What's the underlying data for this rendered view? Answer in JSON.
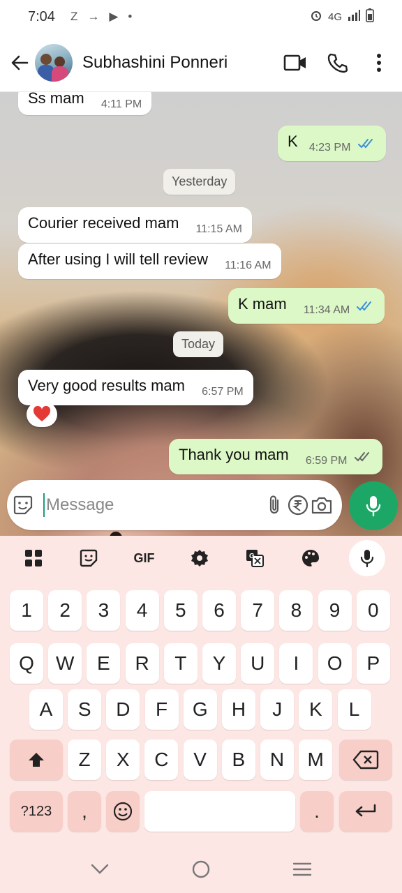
{
  "status_bar": {
    "time": "7:04",
    "icons_left": [
      "Z",
      "→",
      "▶",
      "•"
    ],
    "network": "4G"
  },
  "header": {
    "contact_name": "Subhashini Ponneri"
  },
  "messages": [
    {
      "dir": "in",
      "text": "Ss mam",
      "time": "4:11 PM"
    },
    {
      "dir": "out",
      "text": "K",
      "time": "4:23 PM",
      "read": true
    },
    {
      "dir": "date",
      "text": "Yesterday"
    },
    {
      "dir": "in",
      "text": "Courier received mam",
      "time": "11:15 AM"
    },
    {
      "dir": "in",
      "text": "After using I will tell review",
      "time": "11:16 AM"
    },
    {
      "dir": "out",
      "text": "K mam",
      "time": "11:34 AM",
      "read": true
    },
    {
      "dir": "date",
      "text": "Today"
    },
    {
      "dir": "in",
      "text": "Very good results mam",
      "time": "6:57 PM",
      "reaction": "heart"
    },
    {
      "dir": "out",
      "text": "Thank you mam",
      "time": "6:59 PM",
      "read": false
    }
  ],
  "input": {
    "placeholder": "Message"
  },
  "keyboard": {
    "tools": [
      "apps",
      "sticker",
      "GIF",
      "settings",
      "translate",
      "theme",
      "mic"
    ],
    "row_numbers": [
      "1",
      "2",
      "3",
      "4",
      "5",
      "6",
      "7",
      "8",
      "9",
      "0"
    ],
    "row_top": [
      "Q",
      "W",
      "E",
      "R",
      "T",
      "Y",
      "U",
      "I",
      "O",
      "P"
    ],
    "row_middle": [
      "A",
      "S",
      "D",
      "F",
      "G",
      "H",
      "J",
      "K",
      "L"
    ],
    "row_bottom": [
      "Z",
      "X",
      "C",
      "V",
      "B",
      "N",
      "M"
    ],
    "symbols_key": "?123",
    "comma_key": ",",
    "period_key": "."
  },
  "colors": {
    "out_bubble": "#dcf8c6",
    "accent": "#1da767",
    "tick_read": "#3b8fd9",
    "keyboard_bg": "#fde7e4"
  }
}
